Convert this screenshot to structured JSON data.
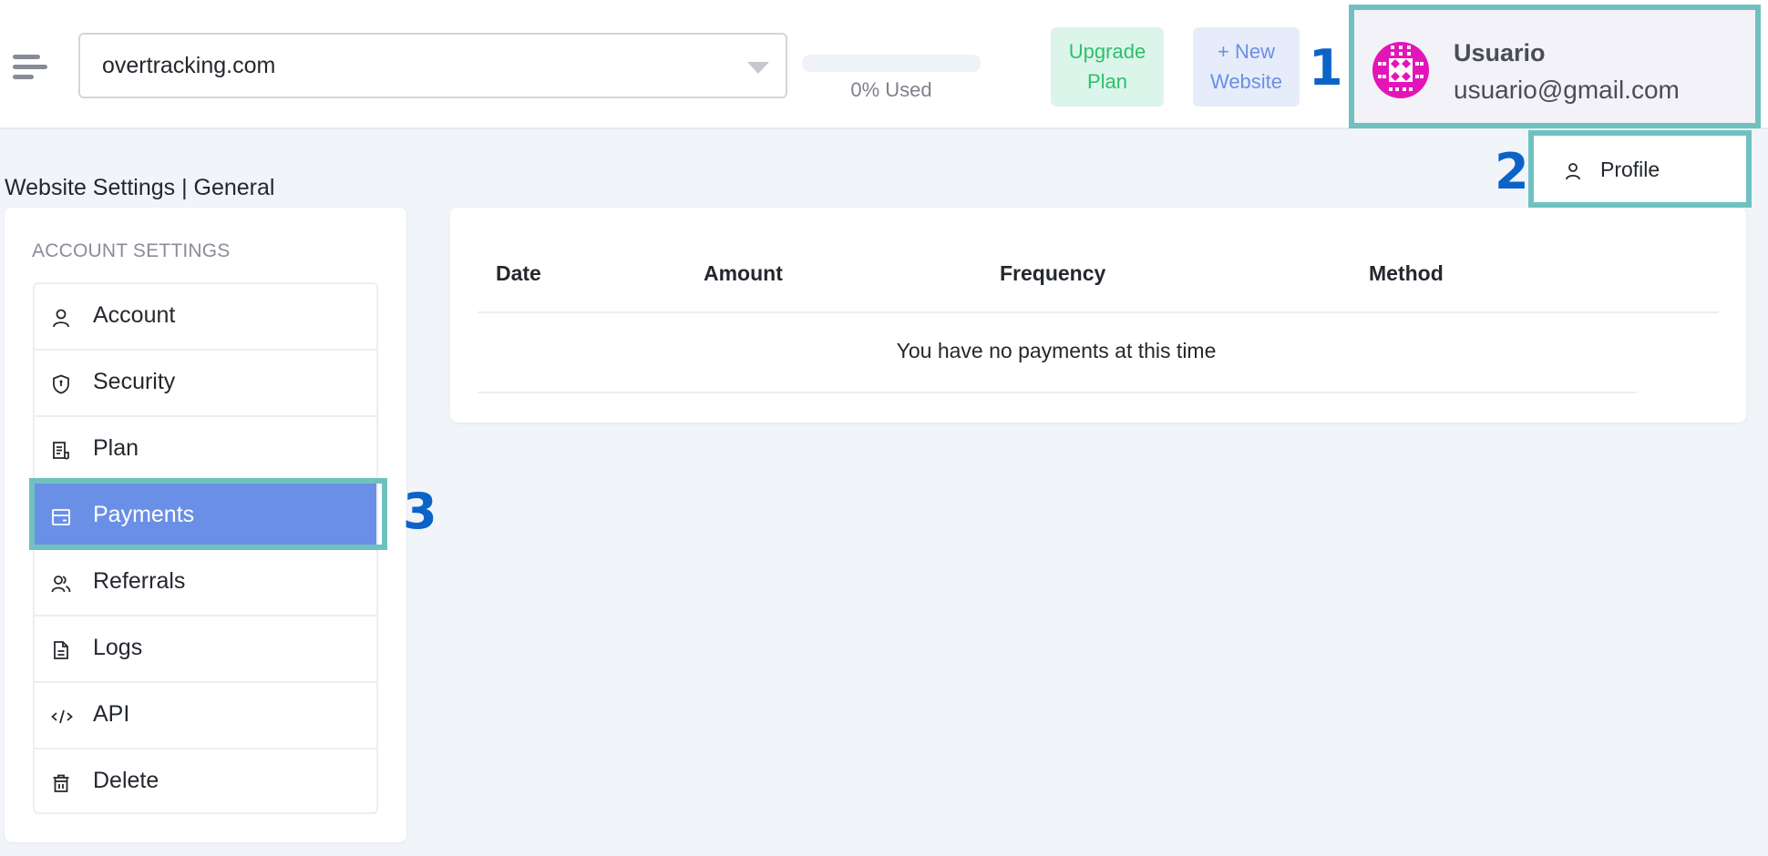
{
  "header": {
    "menu_icon": "hamburger-menu-icon",
    "site_select": {
      "value": "overtracking.com"
    },
    "usage": {
      "percent_used": 0,
      "label": "0% Used"
    },
    "upgrade_button": {
      "line1": "Upgrade",
      "line2": "Plan"
    },
    "new_website_button": {
      "line1": "+ New",
      "line2": "Website"
    },
    "user": {
      "name": "Usuario",
      "email": "usuario@gmail.com"
    }
  },
  "user_menu": {
    "items": [
      {
        "label": "Profile",
        "icon": "user-icon"
      }
    ]
  },
  "markers": [
    "1",
    "2",
    "3"
  ],
  "page": {
    "title": "Website Settings | General"
  },
  "sidebar": {
    "heading": "ACCOUNT SETTINGS",
    "items": [
      {
        "label": "Account",
        "icon": "user-icon"
      },
      {
        "label": "Security",
        "icon": "shield-icon"
      },
      {
        "label": "Plan",
        "icon": "receipt-icon"
      },
      {
        "label": "Payments",
        "icon": "credit-card-icon",
        "active": true
      },
      {
        "label": "Referrals",
        "icon": "users-icon"
      },
      {
        "label": "Logs",
        "icon": "document-icon"
      },
      {
        "label": "API",
        "icon": "code-icon"
      },
      {
        "label": "Delete",
        "icon": "trash-icon"
      }
    ]
  },
  "payments_table": {
    "columns": [
      "Date",
      "Amount",
      "Frequency",
      "Method"
    ],
    "rows": [],
    "empty_message": "You have no payments at this time"
  },
  "colors": {
    "accent": "#6a8fe6",
    "success": "#2cc06c",
    "highlight_outline": "#6fc1c0",
    "marker": "#0b63c8",
    "avatar": "#e315b9"
  }
}
